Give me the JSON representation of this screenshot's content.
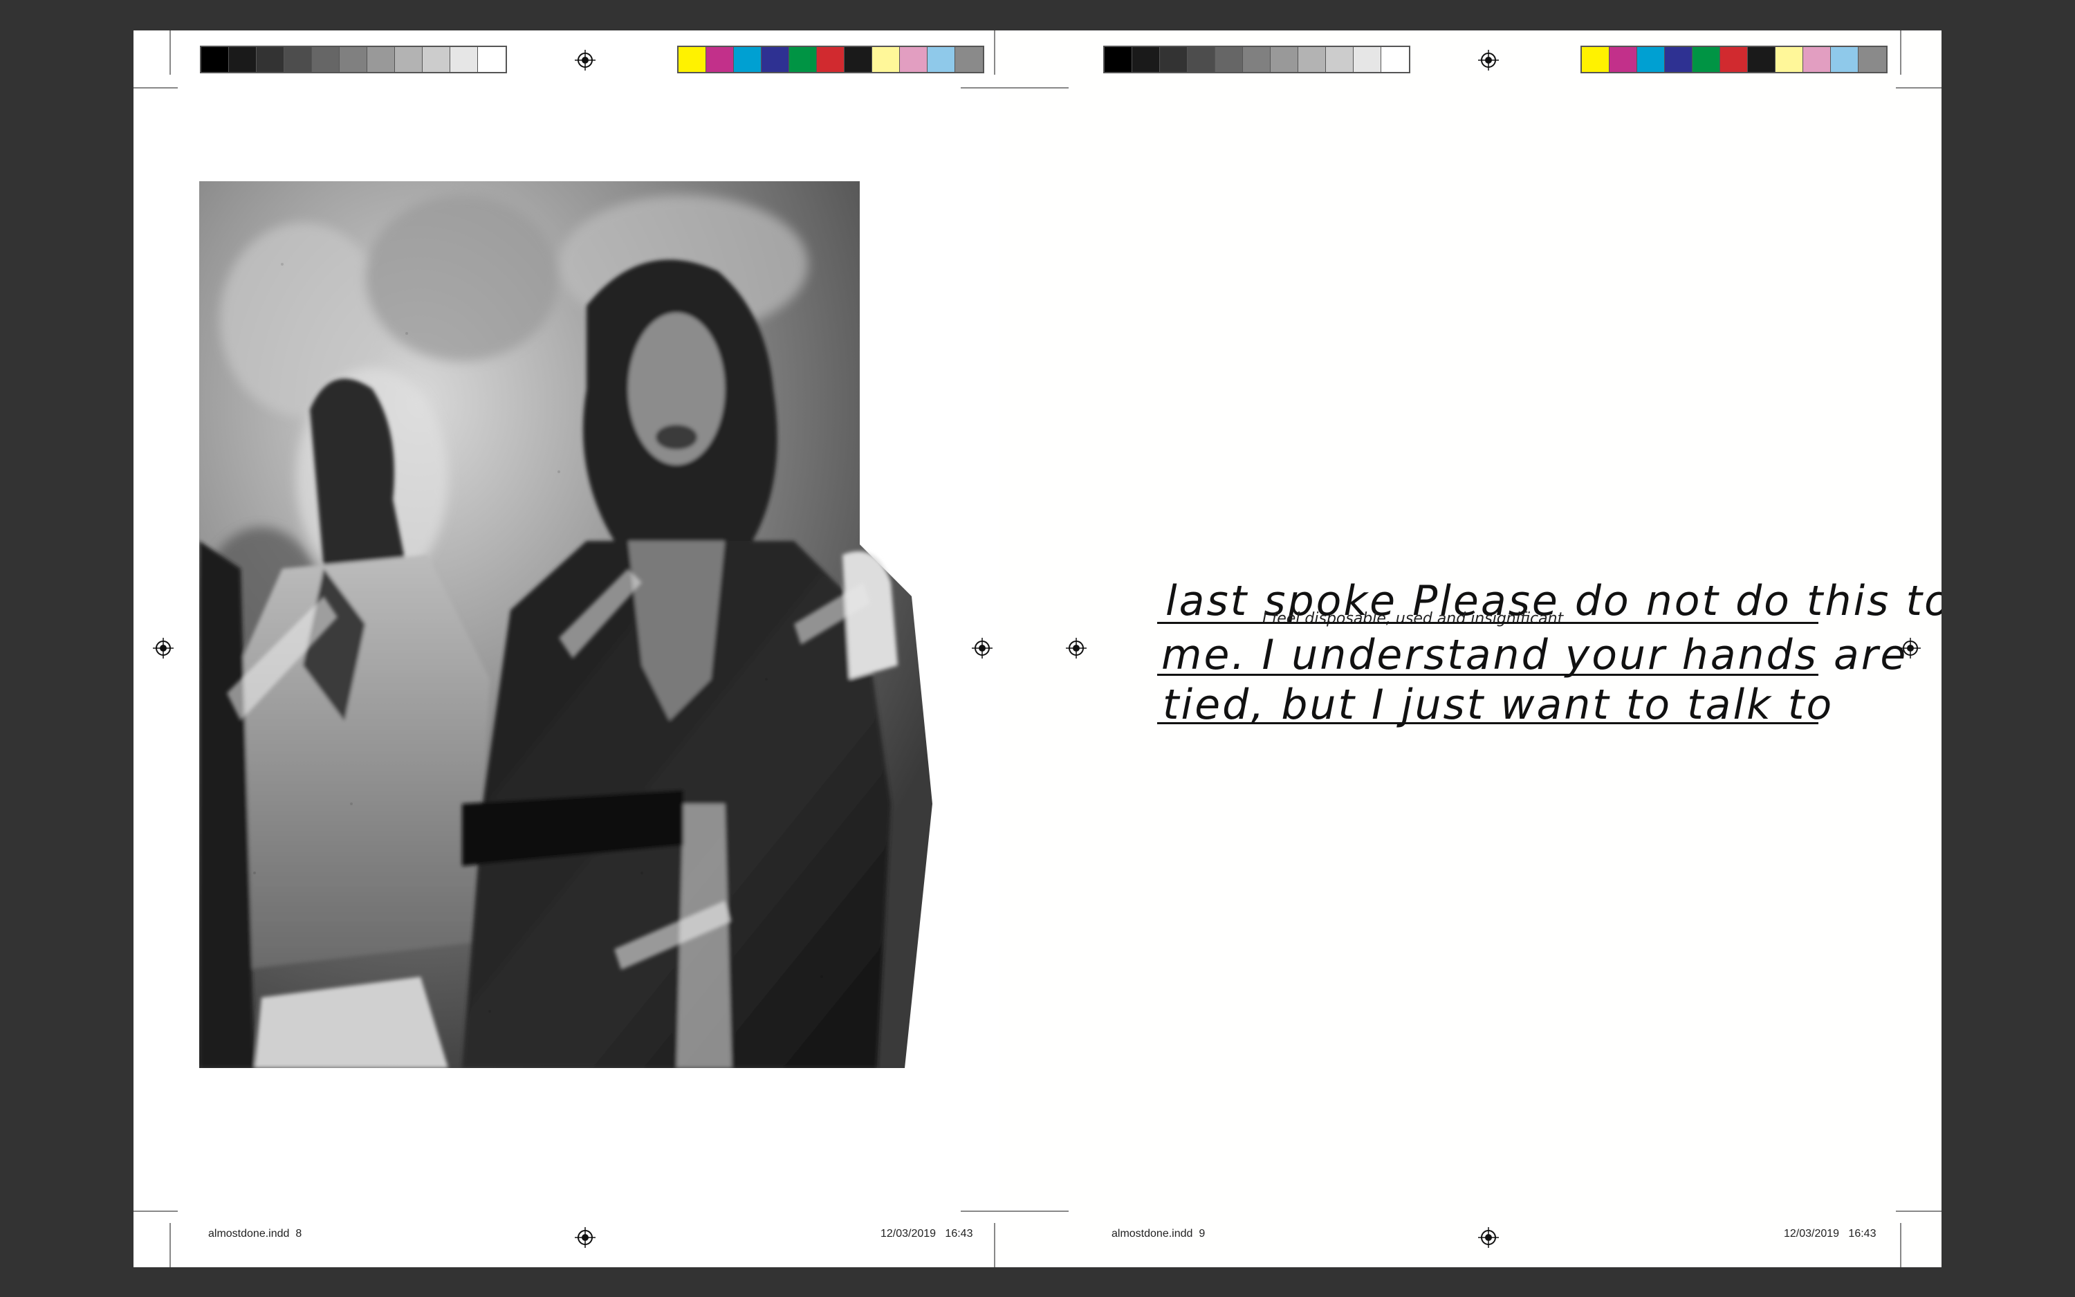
{
  "spread": {
    "left": {
      "slug_file": "almostdone.indd",
      "slug_page": "8",
      "slug_date": "12/03/2019",
      "slug_time": "16:43"
    },
    "right": {
      "slug_file": "almostdone.indd",
      "slug_page": "9",
      "slug_date": "12/03/2019",
      "slug_time": "16:43"
    }
  },
  "color_bars": {
    "grayscale": [
      "#000000",
      "#1a1a1a",
      "#333333",
      "#4d4d4d",
      "#666666",
      "#808080",
      "#999999",
      "#b3b3b3",
      "#cccccc",
      "#e6e6e6",
      "#ffffff"
    ],
    "process": [
      "#fff200",
      "#c2308a",
      "#00a0d2",
      "#2e3192",
      "#009444",
      "#d12a2f",
      "#1a1a1a",
      "#fff799",
      "#e29ec1",
      "#8fc9ea",
      "#8a8a8a"
    ]
  },
  "handwriting": {
    "line1": "last spoke Please do not do this to",
    "line1_insert": "I feel disposable, used and insignificant",
    "line2": "me. I understand your hands are",
    "line3": "tied, but I just want to talk to"
  }
}
